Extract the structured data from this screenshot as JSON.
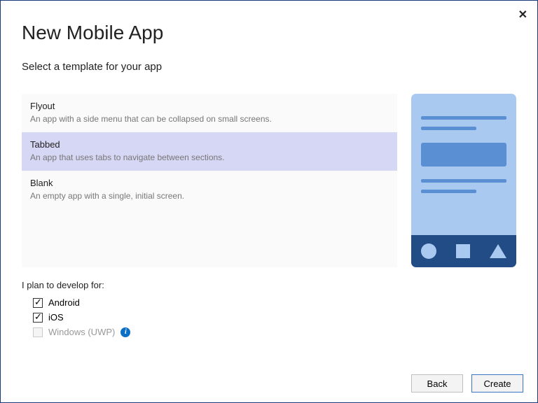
{
  "title": "New Mobile App",
  "subtitle": "Select a template for your app",
  "templates": [
    {
      "name": "Flyout",
      "desc": "An app with a side menu that can be collapsed on small screens.",
      "selected": false
    },
    {
      "name": "Tabbed",
      "desc": "An app that uses tabs to navigate between sections.",
      "selected": true
    },
    {
      "name": "Blank",
      "desc": "An empty app with a single, initial screen.",
      "selected": false
    }
  ],
  "develop_label": "I plan to develop for:",
  "platforms": [
    {
      "label": "Android",
      "checked": true,
      "disabled": false,
      "info": false
    },
    {
      "label": "iOS",
      "checked": true,
      "disabled": false,
      "info": false
    },
    {
      "label": "Windows (UWP)",
      "checked": false,
      "disabled": true,
      "info": true
    }
  ],
  "buttons": {
    "back": "Back",
    "create": "Create"
  },
  "close_glyph": "✕"
}
